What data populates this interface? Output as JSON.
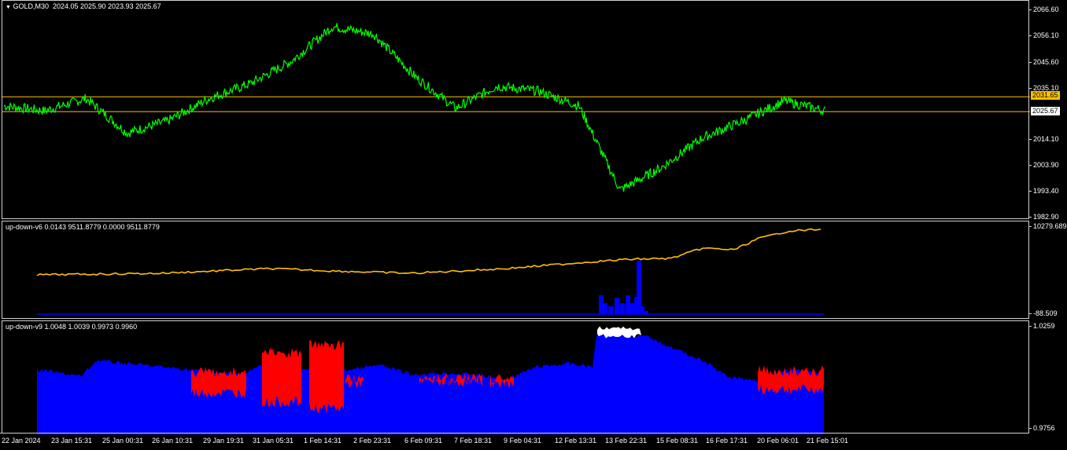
{
  "main": {
    "label_arrow": "▼",
    "label_symbol": "GOLD,M30",
    "label_ohlc": "2024.05 2025.90 2023.93 2025.67",
    "y_ticks": [
      "2066.60",
      "2056.10",
      "2045.60",
      "2035.10",
      "2014.10",
      "2003.90",
      "1993.40",
      "1982.90"
    ],
    "yellow_line_value": "2031.65",
    "current_price_value": "2025.67",
    "line_color": "#00ff00",
    "hline_color": "#ffc000"
  },
  "indicator1": {
    "label": "up-down-v6 0.0143 9511.8779 0.0000 9511.8779",
    "y_ticks": [
      "10279.689",
      "-88.509"
    ],
    "line_color": "#ffc000",
    "hist_color": "#0000ff"
  },
  "indicator2": {
    "label": "up-down-v9 1.0048 1.0039 0.9973 0.9960",
    "y_ticks": [
      "1.0259",
      "0.9756"
    ],
    "up_color": "#0000ff",
    "down_color": "#ff0000"
  },
  "x_ticks": [
    "22 Jan 2024",
    "23 Jan 15:31",
    "25 Jan 00:31",
    "26 Jan 10:31",
    "29 Jan 19:31",
    "31 Jan 05:31",
    "1 Feb 14:31",
    "2 Feb 23:31",
    "6 Feb 09:31",
    "7 Feb 18:31",
    "9 Feb 04:31",
    "12 Feb 13:31",
    "13 Feb 22:31",
    "15 Feb 08:31",
    "16 Feb 17:31",
    "20 Feb 06:01",
    "21 Feb 15:01"
  ],
  "chart_data": {
    "type": "line",
    "title": "GOLD,M30",
    "xlabel": "",
    "ylabel": "",
    "categories": [
      "22 Jan 2024",
      "23 Jan 15:31",
      "25 Jan 00:31",
      "26 Jan 10:31",
      "29 Jan 19:31",
      "31 Jan 05:31",
      "1 Feb 14:31",
      "2 Feb 23:31",
      "6 Feb 09:31",
      "7 Feb 18:31",
      "9 Feb 04:31",
      "12 Feb 13:31",
      "13 Feb 22:31",
      "15 Feb 08:31",
      "16 Feb 17:31",
      "20 Feb 06:01",
      "21 Feb 15:01"
    ],
    "series": [
      {
        "values": [
          2028,
          2026,
          2031,
          2017,
          2022,
          2031,
          2037,
          2046,
          2060,
          2057,
          2040,
          2027,
          2036,
          2034,
          2028,
          1994,
          2003,
          2015,
          2022,
          2030,
          2026
        ]
      }
    ],
    "ylim": [
      1982.9,
      2066.6
    ],
    "reference_lines": [
      2031.65,
      2025.67
    ]
  }
}
